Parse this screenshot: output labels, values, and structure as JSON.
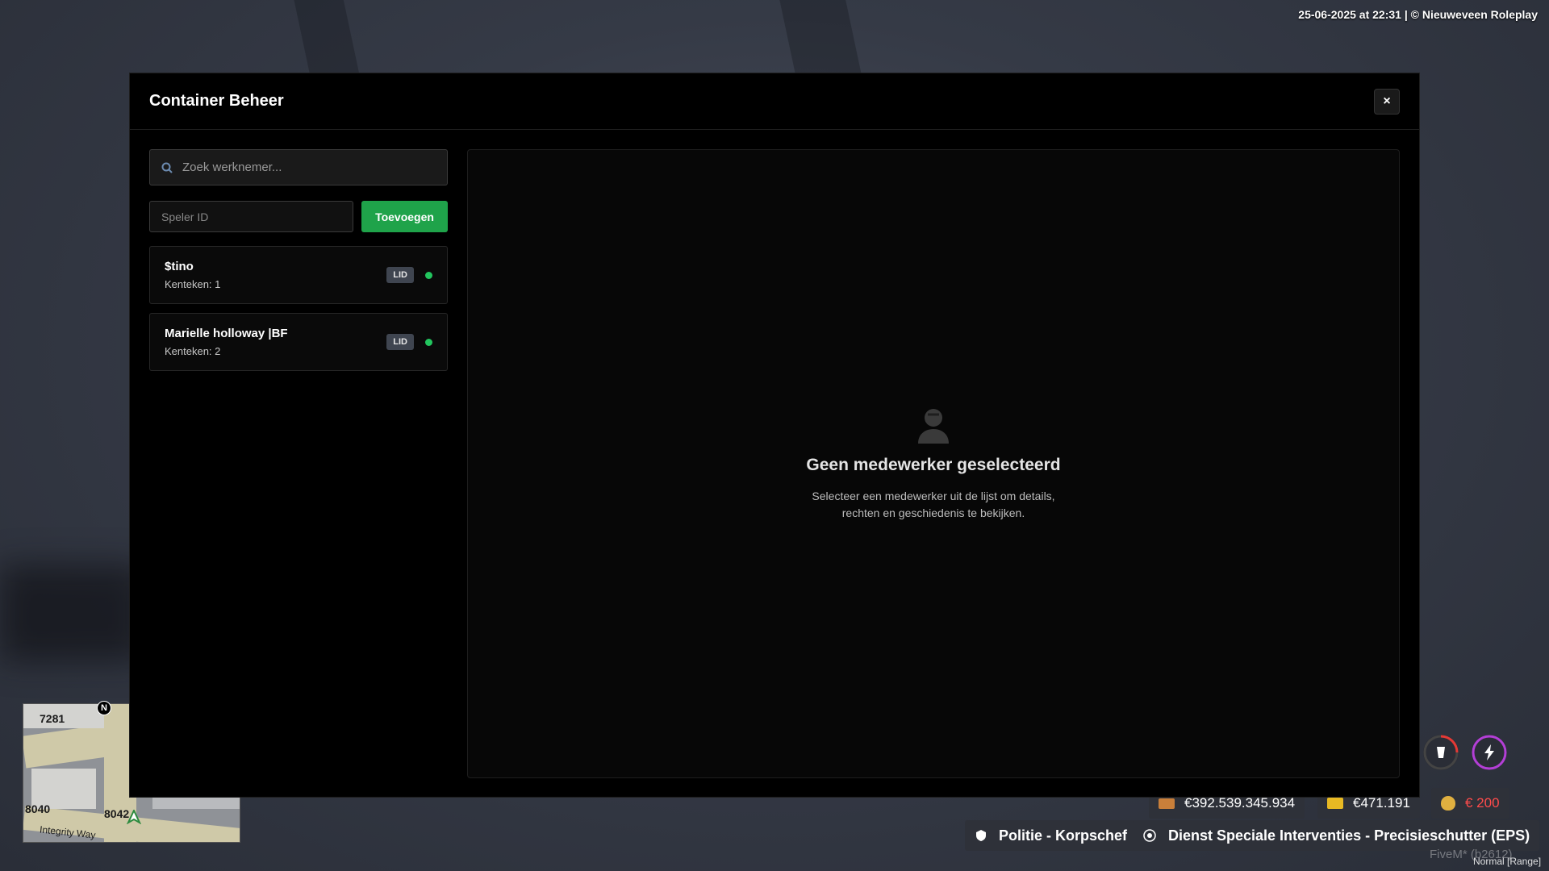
{
  "hud": {
    "timestamp": "25-06-2025 at 22:31 | © Nieuweveen Roleplay",
    "cash": "€392.539.345.934",
    "bank": "€471.191",
    "black_money": "€ 200",
    "job": "Politie - Korpschef",
    "grade": "Dienst Speciale Interventies - Precisieschutter (EPS)",
    "fivem": "FiveM* (b2612)",
    "mode": "Normal [Range]",
    "colors": {
      "cash_icon": "#c97f3a",
      "bank_icon": "#e8b923",
      "black_money": "#ff4b4b",
      "hunger_ring": "#e53935",
      "energy_ring": "#b33fd6"
    }
  },
  "minimap": {
    "labels": [
      "7281",
      "8040",
      "8042"
    ],
    "street": "Integrity Way",
    "north": "N"
  },
  "modal": {
    "title": "Container Beheer",
    "close_label": "×",
    "search_placeholder": "Zoek werknemer...",
    "player_id_placeholder": "Speler ID",
    "add_button": "Toevoegen",
    "employees": [
      {
        "name": "$tino",
        "plates": "Kenteken: 1",
        "role": "LID",
        "online": true
      },
      {
        "name": "Marielle holloway |BF",
        "plates": "Kenteken: 2",
        "role": "LID",
        "online": true
      }
    ],
    "empty_state": {
      "icon": "user-icon",
      "title": "Geen medewerker geselecteerd",
      "description_line1": "Selecteer een medewerker uit de lijst om details,",
      "description_line2": "rechten en geschiedenis te bekijken."
    },
    "accent_color": "#1fa34a"
  }
}
